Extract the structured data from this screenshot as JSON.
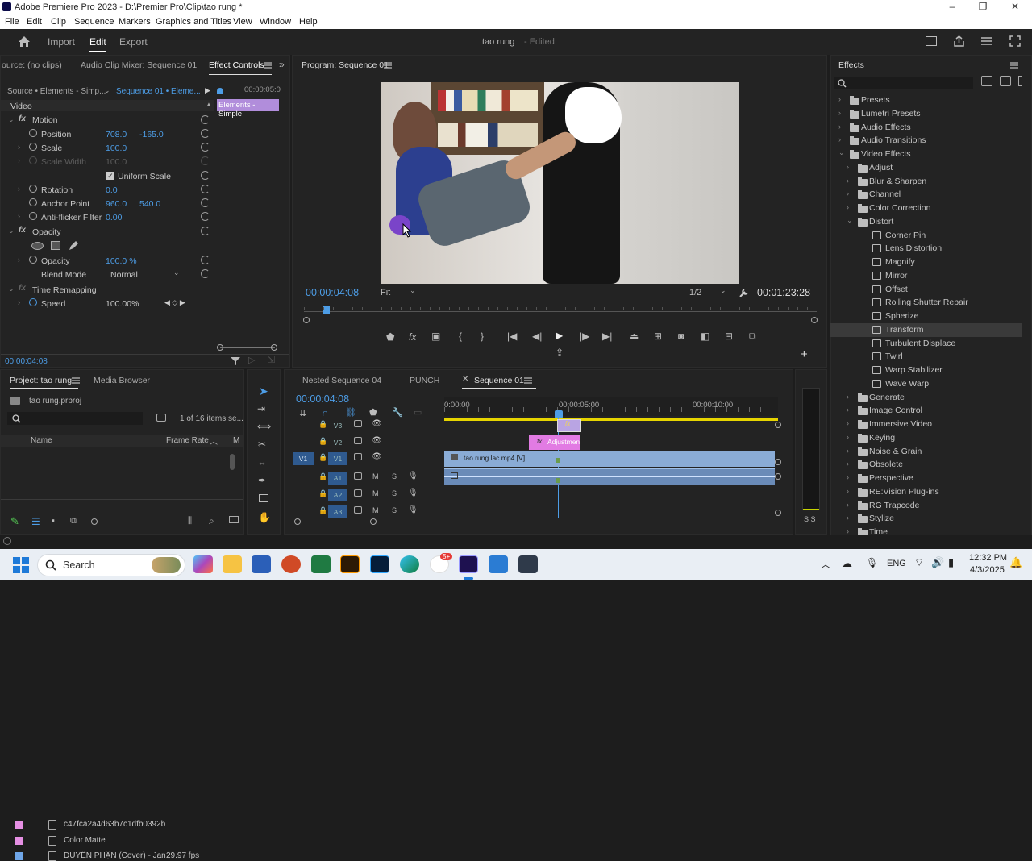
{
  "window": {
    "title": "Adobe Premiere Pro 2023 - D:\\Premier Pro\\Clip\\tao rung *",
    "minimize": "–",
    "maximize": "❐",
    "close": "✕"
  },
  "menu": [
    "File",
    "Edit",
    "Clip",
    "Sequence",
    "Markers",
    "Graphics and Titles",
    "View",
    "Window",
    "Help"
  ],
  "workspace": {
    "import": "Import",
    "edit": "Edit",
    "export": "Export",
    "project_name": "tao rung",
    "edited": "- Edited"
  },
  "effect_controls": {
    "tab_source": "ource: (no clips)",
    "tab_mixer": "Audio Clip Mixer: Sequence 01",
    "tab_effect": "Effect Controls",
    "source_label": "Source • Elements - Simp...",
    "sequence_label": "Sequence 01 • Eleme...",
    "timecode_top": "00:00:05:0",
    "clip_label": "Elements - Simple",
    "video_header": "Video",
    "motion": "Motion",
    "position": {
      "label": "Position",
      "x": "708.0",
      "y": "-165.0"
    },
    "scale": {
      "label": "Scale",
      "value": "100.0"
    },
    "scale_width": {
      "label": "Scale Width",
      "value": "100.0"
    },
    "uniform_scale": "Uniform Scale",
    "rotation": {
      "label": "Rotation",
      "value": "0.0"
    },
    "anchor": {
      "label": "Anchor Point",
      "x": "960.0",
      "y": "540.0"
    },
    "antiflicker": {
      "label": "Anti-flicker Filter",
      "value": "0.00"
    },
    "opacity_group": "Opacity",
    "opacity": {
      "label": "Opacity",
      "value": "100.0 %"
    },
    "blend": {
      "label": "Blend Mode",
      "value": "Normal"
    },
    "time_remap": "Time Remapping",
    "speed": {
      "label": "Speed",
      "value": "100.00%"
    },
    "timecode_bottom": "00:00:04:08"
  },
  "program": {
    "title": "Program: Sequence 01",
    "timecode": "00:00:04:08",
    "fit": "Fit",
    "resolution": "1/2",
    "duration": "00:01:23:28"
  },
  "effects": {
    "title": "Effects",
    "items": [
      {
        "label": "Presets",
        "level": 0,
        "type": "folder"
      },
      {
        "label": "Lumetri Presets",
        "level": 0,
        "type": "folder"
      },
      {
        "label": "Audio Effects",
        "level": 0,
        "type": "folder"
      },
      {
        "label": "Audio Transitions",
        "level": 0,
        "type": "folder"
      },
      {
        "label": "Video Effects",
        "level": 0,
        "type": "folder",
        "open": true
      },
      {
        "label": "Adjust",
        "level": 1,
        "type": "folder"
      },
      {
        "label": "Blur & Sharpen",
        "level": 1,
        "type": "folder"
      },
      {
        "label": "Channel",
        "level": 1,
        "type": "folder"
      },
      {
        "label": "Color Correction",
        "level": 1,
        "type": "folder"
      },
      {
        "label": "Distort",
        "level": 1,
        "type": "folder",
        "open": true
      },
      {
        "label": "Corner Pin",
        "level": 2,
        "type": "fx"
      },
      {
        "label": "Lens Distortion",
        "level": 2,
        "type": "fx"
      },
      {
        "label": "Magnify",
        "level": 2,
        "type": "fx"
      },
      {
        "label": "Mirror",
        "level": 2,
        "type": "fx"
      },
      {
        "label": "Offset",
        "level": 2,
        "type": "fx"
      },
      {
        "label": "Rolling Shutter Repair",
        "level": 2,
        "type": "fx"
      },
      {
        "label": "Spherize",
        "level": 2,
        "type": "fx"
      },
      {
        "label": "Transform",
        "level": 2,
        "type": "fx",
        "selected": true
      },
      {
        "label": "Turbulent Displace",
        "level": 2,
        "type": "fx"
      },
      {
        "label": "Twirl",
        "level": 2,
        "type": "fx"
      },
      {
        "label": "Warp Stabilizer",
        "level": 2,
        "type": "fx"
      },
      {
        "label": "Wave Warp",
        "level": 2,
        "type": "fx"
      },
      {
        "label": "Generate",
        "level": 1,
        "type": "folder"
      },
      {
        "label": "Image Control",
        "level": 1,
        "type": "folder"
      },
      {
        "label": "Immersive Video",
        "level": 1,
        "type": "folder"
      },
      {
        "label": "Keying",
        "level": 1,
        "type": "folder"
      },
      {
        "label": "Noise & Grain",
        "level": 1,
        "type": "folder"
      },
      {
        "label": "Obsolete",
        "level": 1,
        "type": "folder"
      },
      {
        "label": "Perspective",
        "level": 1,
        "type": "folder"
      },
      {
        "label": "RE:Vision Plug-ins",
        "level": 1,
        "type": "folder"
      },
      {
        "label": "RG Trapcode",
        "level": 1,
        "type": "folder"
      },
      {
        "label": "Stylize",
        "level": 1,
        "type": "folder"
      },
      {
        "label": "Time",
        "level": 1,
        "type": "folder"
      }
    ]
  },
  "project": {
    "tab": "Project: tao rung",
    "media_browser": "Media Browser",
    "file": "tao rung.prproj",
    "count": "1 of 16 items se...",
    "col_name": "Name",
    "col_rate": "Frame Rate",
    "col_m": "M",
    "rows": [
      {
        "name": "c47fca2a4d63b7c1dfb0392b",
        "rate": "",
        "color": "#e58fe3"
      },
      {
        "name": "Color Matte",
        "rate": "",
        "color": "#e58fe3"
      },
      {
        "name": "DUYÊN PHẬN (Cover) - Jan",
        "rate": "29.97 fps",
        "color": "#6fa6e8"
      }
    ]
  },
  "timeline": {
    "tabs": [
      "Nested Sequence 04",
      "PUNCH",
      "Sequence 01"
    ],
    "timecode": "00:00:04:08",
    "ruler": [
      "0:00:00",
      "00:00:05:00",
      "00:00:10:00"
    ],
    "tracks": [
      "V3",
      "V2",
      "V1",
      "A1",
      "A2",
      "A3"
    ],
    "m": "M",
    "s": "S",
    "target_v1": "V1",
    "clip_v1": "tao rung lac.mp4 [V]",
    "clip_adj": "Adjustmen",
    "meter_s": "S S"
  },
  "taskbar": {
    "search": "Search",
    "lang": "ENG",
    "time": "12:32 PM",
    "date": "4/3/2025",
    "badge": "5+"
  }
}
